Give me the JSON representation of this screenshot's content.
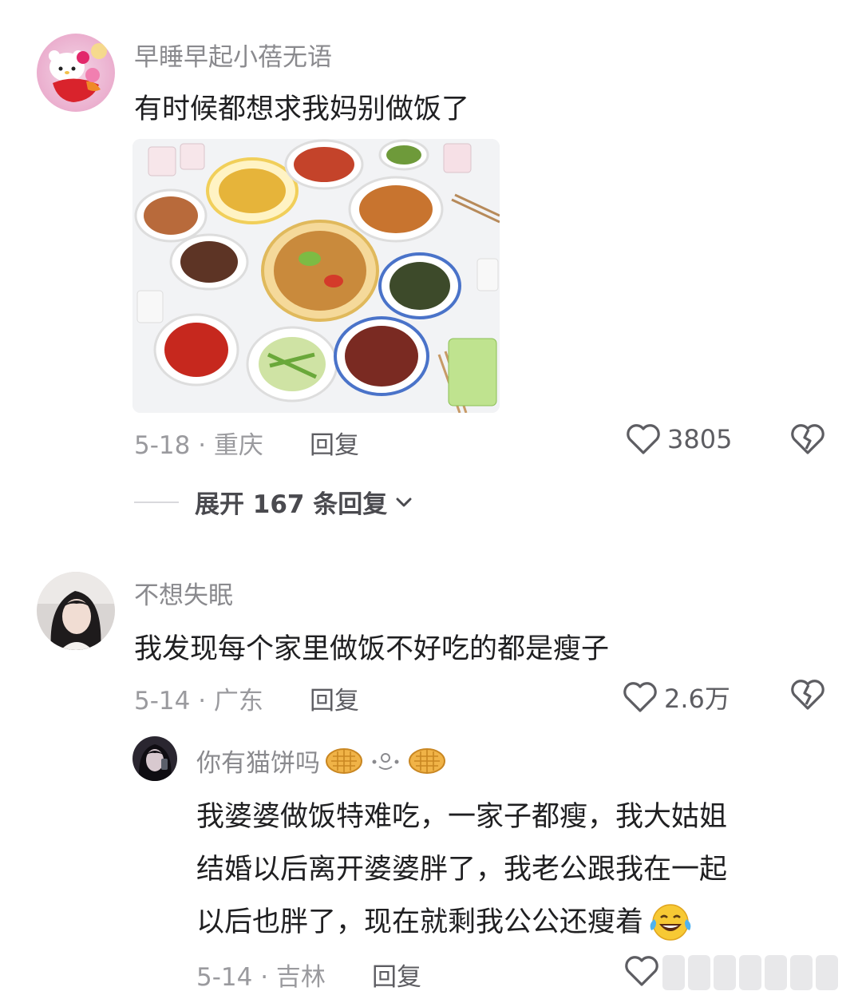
{
  "comments": [
    {
      "username": "早睡早起小蓓无语",
      "text": "有时候都想求我妈别做饭了",
      "meta": "5-18 · 重庆",
      "reply_label": "回复",
      "likes": "3805",
      "expand_label": "展开 167 条回复",
      "avatar_icon": "hello-kitty-avatar-icon",
      "image": "food-table-photo"
    },
    {
      "username": "不想失眠",
      "text": "我发现每个家里做饭不好吃的都是瘦子",
      "meta": "5-14 · 广东",
      "reply_label": "回复",
      "likes": "2.6万",
      "avatar_icon": "girl-portrait-avatar-icon"
    }
  ],
  "reply": {
    "username": "你有猫饼吗",
    "username_emoji": [
      "waffle-icon",
      "face-icon",
      "waffle-icon"
    ],
    "lines": [
      "我婆婆做饭特难吃，一家子都瘦，我大姑姐",
      "结婚以后离开婆婆胖了，我老公跟我在一起",
      "以后也胖了，现在就剩我公公还瘦着"
    ],
    "end_emoji": "laughing-tears-icon",
    "meta": "5-14 · 吉林",
    "reply_label": "回复",
    "avatar_icon": "dark-portrait-avatar-icon"
  },
  "colors": {
    "username": "#8a8a8e",
    "text": "#1f1f21",
    "meta": "#9a9a9e",
    "icon": "#5d5d62"
  }
}
